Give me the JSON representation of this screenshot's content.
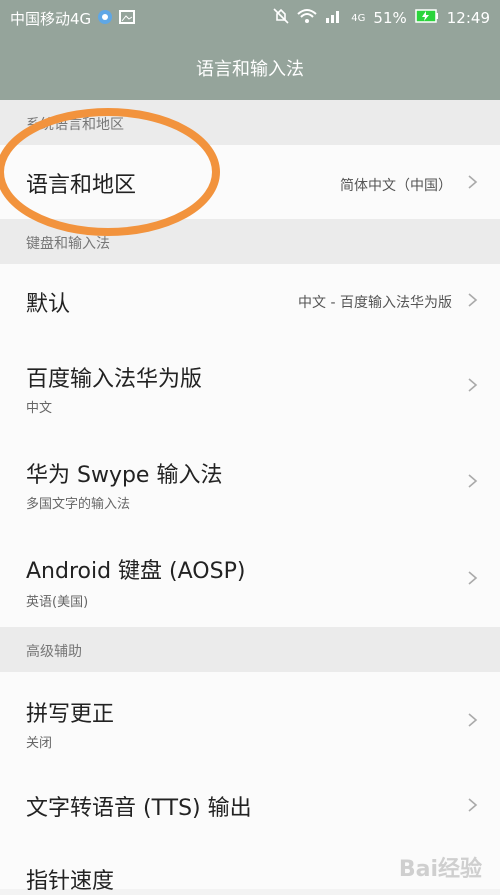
{
  "status_bar": {
    "carrier": "中国移动4G",
    "network": "4G",
    "battery": "51%",
    "time": "12:49",
    "icons": [
      "weather-icon",
      "image-icon",
      "mute-icon",
      "wifi-icon",
      "signal-icon",
      "battery-icon"
    ]
  },
  "header": {
    "title": "语言和输入法"
  },
  "sections": {
    "system_language_region": "系统语言和地区",
    "keyboard_input": "键盘和输入法",
    "advanced_assist": "高级辅助"
  },
  "rows": {
    "language_region": {
      "title": "语言和地区",
      "value": "简体中文（中国）"
    },
    "default": {
      "title": "默认",
      "value": "中文 - 百度输入法华为版"
    },
    "baidu_ime": {
      "title": "百度输入法华为版",
      "sub": "中文"
    },
    "huawei_swype": {
      "title": "华为 Swype 输入法",
      "sub": "多国文字的输入法"
    },
    "android_keyboard": {
      "title": "Android 键盘 (AOSP)",
      "sub": "英语(美国)"
    },
    "spell_check": {
      "title": "拼写更正",
      "sub": "关闭"
    },
    "tts_output": {
      "title": "文字转语音 (TTS) 输出"
    },
    "pointer_speed": {
      "title": "指针速度"
    }
  },
  "watermark": {
    "text": "Bai经验"
  },
  "colors": {
    "header": "#95a49b",
    "annotation": "#f2933d",
    "background": "#f3f3f3"
  }
}
